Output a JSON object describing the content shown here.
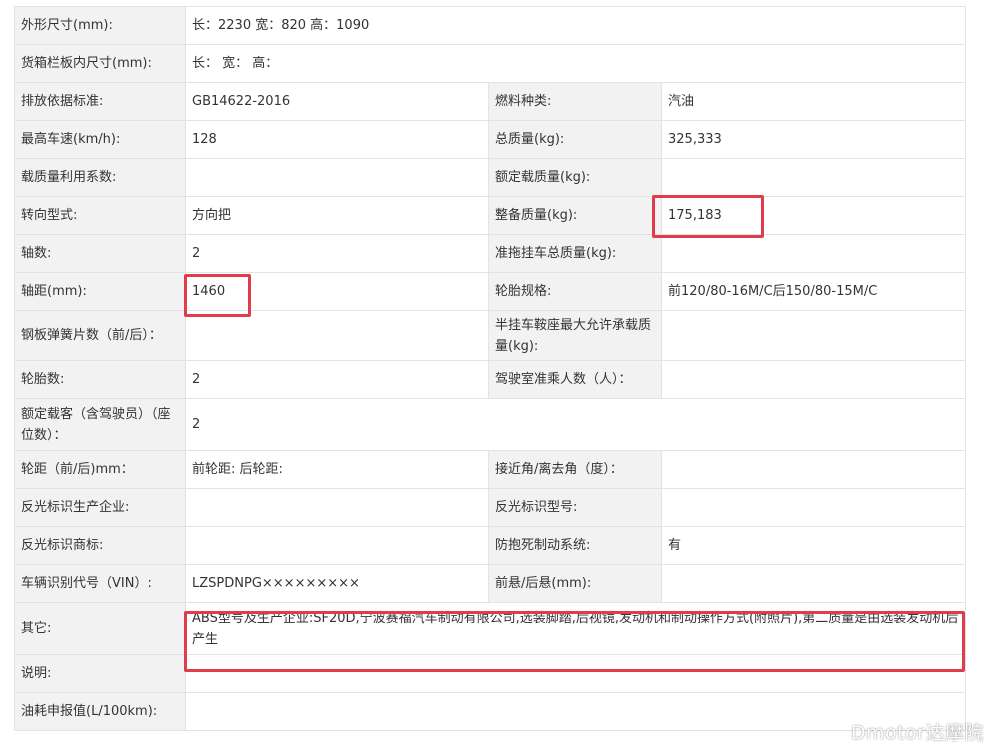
{
  "rows": {
    "r1": {
      "l1": "外形尺寸(mm):",
      "v1": "长：2230 宽：820 高：1090"
    },
    "r2": {
      "l1": "货箱栏板内尺寸(mm):",
      "v1": "长： 宽： 高："
    },
    "r3": {
      "l1": "排放依据标准:",
      "v1": "GB14622-2016",
      "l2": "燃料种类:",
      "v2": "汽油"
    },
    "r4": {
      "l1": "最高车速(km/h):",
      "v1": "128",
      "l2": "总质量(kg):",
      "v2": "325,333"
    },
    "r5": {
      "l1": "载质量利用系数:",
      "v1": "",
      "l2": "额定载质量(kg):",
      "v2": ""
    },
    "r6": {
      "l1": "转向型式:",
      "v1": "方向把",
      "l2": "整备质量(kg):",
      "v2": "175,183"
    },
    "r7": {
      "l1": "轴数:",
      "v1": "2",
      "l2": "准拖挂车总质量(kg):",
      "v2": ""
    },
    "r8": {
      "l1": "轴距(mm):",
      "v1": "1460",
      "l2": "轮胎规格:",
      "v2": "前120/80-16M/C后150/80-15M/C"
    },
    "r9": {
      "l1": "钢板弹簧片数（前/后）：",
      "v1": "",
      "l2": "半挂车鞍座最大允许承载质量(kg):",
      "v2": ""
    },
    "r10": {
      "l1": "轮胎数:",
      "v1": "2",
      "l2": "驾驶室准乘人数（人）：",
      "v2": ""
    },
    "r11": {
      "l1": "额定载客（含驾驶员）（座位数）：",
      "v1": "2"
    },
    "r12": {
      "l1": "轮距（前/后)mm：",
      "v1": "前轮距: 后轮距:",
      "l2": "接近角/离去角（度）：",
      "v2": ""
    },
    "r13": {
      "l1": "反光标识生产企业:",
      "v1": "",
      "l2": "反光标识型号:",
      "v2": ""
    },
    "r14": {
      "l1": "反光标识商标:",
      "v1": "",
      "l2": "防抱死制动系统:",
      "v2": "有"
    },
    "r15": {
      "l1": "车辆识别代号（VIN）:",
      "v1": "LZSPDNPG×××××××××",
      "l2": "前悬/后悬(mm):",
      "v2": ""
    },
    "r16": {
      "l1": "其它:",
      "v1": "ABS型号及生产企业:SF20D,宁波赛福汽车制动有限公司,选装脚踏,后视镜,发动机和制动操作方式(附照片),第二质量是由选装发动机后产生"
    },
    "r17": {
      "l1": "说明:",
      "v1": ""
    },
    "r18": {
      "l1": "油耗申报值(L/100km):",
      "v1": ""
    }
  },
  "watermark": "Dmotor达摩院",
  "highlight_color": "#e03c4b"
}
